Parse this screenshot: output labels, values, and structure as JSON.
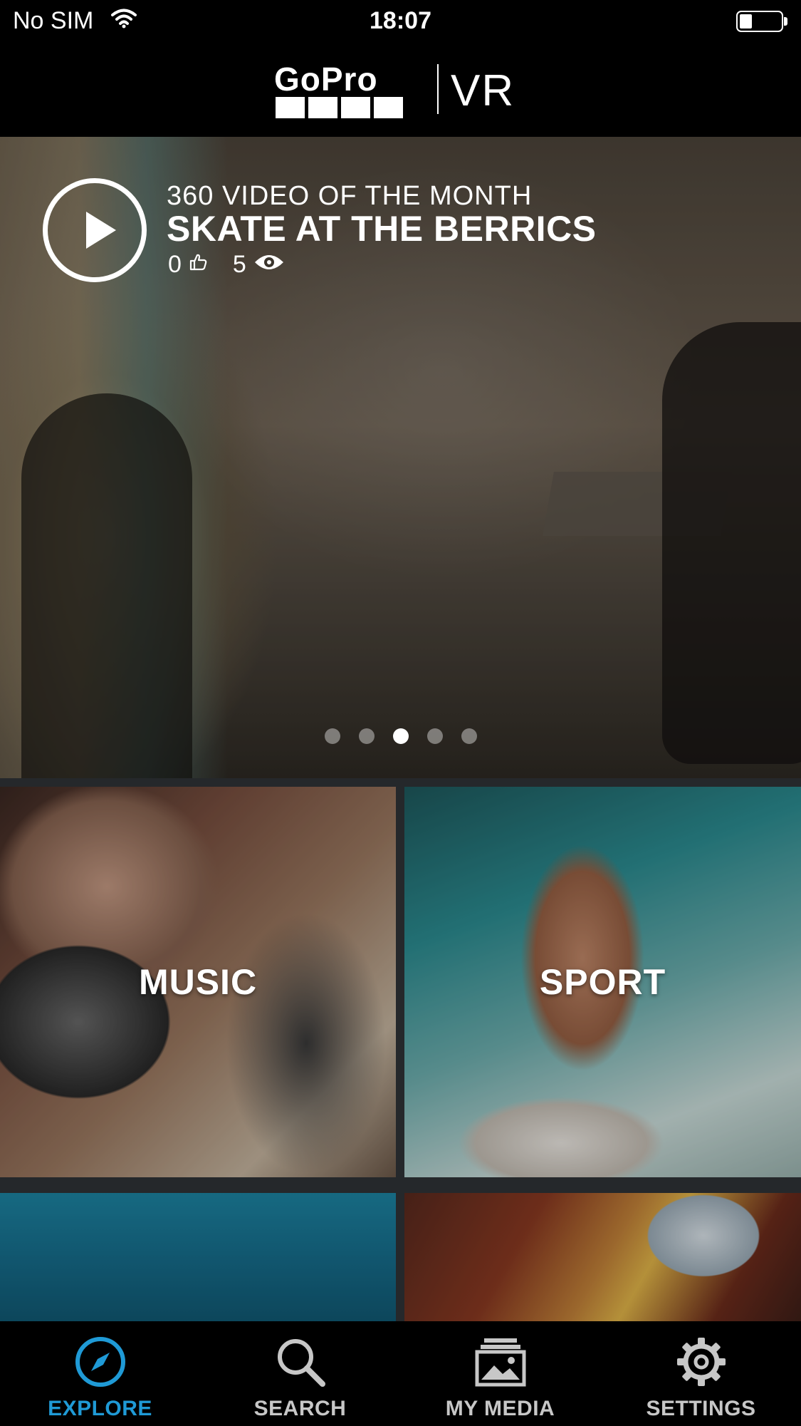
{
  "status_bar": {
    "carrier": "No SIM",
    "time": "18:07",
    "battery_level": 0.3
  },
  "header": {
    "logo_text": "GoPro",
    "logo_suffix": "VR"
  },
  "hero": {
    "kicker": "360 VIDEO OF THE MONTH",
    "title": "SKATE AT THE BERRICS",
    "likes": "0",
    "views": "5",
    "page_count": 5,
    "active_page_index": 2,
    "icons": [
      "play-icon",
      "thumbs-up-icon",
      "eye-icon"
    ]
  },
  "categories": [
    {
      "label": "MUSIC"
    },
    {
      "label": "SPORT"
    },
    {
      "label": ""
    },
    {
      "label": ""
    }
  ],
  "tabbar": {
    "active_color": "#1f9ad6",
    "inactive_color": "#c7c7c7",
    "tabs": [
      {
        "label": "EXPLORE",
        "icon": "compass-icon",
        "active": true
      },
      {
        "label": "SEARCH",
        "icon": "search-icon",
        "active": false
      },
      {
        "label": "MY MEDIA",
        "icon": "media-stack-icon",
        "active": false
      },
      {
        "label": "SETTINGS",
        "icon": "gear-icon",
        "active": false
      }
    ]
  }
}
